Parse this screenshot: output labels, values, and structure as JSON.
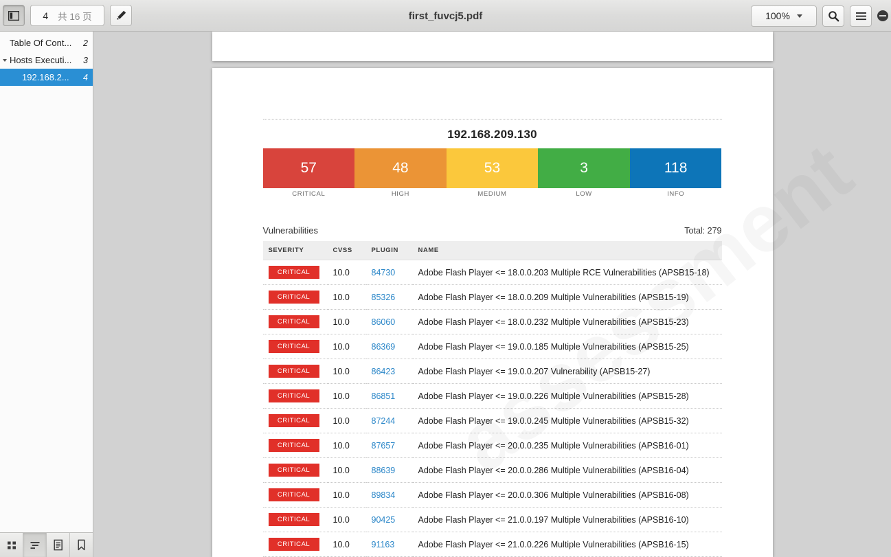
{
  "window": {
    "title": "first_fuvcj5.pdf"
  },
  "toolbar": {
    "sidebar_toggle_icon": "sidebar-panel-icon",
    "current_page": "4",
    "page_total_label": "共 16 页",
    "edit_icon": "pencil-icon",
    "zoom_level": "100%",
    "zoom_caret_icon": "chevron-down-icon",
    "search_icon": "search-icon",
    "menu_icon": "hamburger-menu-icon",
    "minimize_icon": "minimize-icon"
  },
  "sidebar": {
    "outline": [
      {
        "label": "Table Of Cont...",
        "page": "2",
        "expandable": false,
        "indent": false,
        "selected": false
      },
      {
        "label": "Hosts Executi...",
        "page": "3",
        "expandable": true,
        "indent": false,
        "selected": false
      },
      {
        "label": "192.168.2...",
        "page": "4",
        "expandable": false,
        "indent": true,
        "selected": true
      }
    ],
    "tabs": [
      {
        "name": "thumbnails-tab",
        "icon": "grid-icon",
        "active": false
      },
      {
        "name": "outline-tab",
        "icon": "outline-list-icon",
        "active": true
      },
      {
        "name": "annotations-tab",
        "icon": "notepad-icon",
        "active": false
      },
      {
        "name": "bookmarks-tab",
        "icon": "bookmark-icon",
        "active": false
      }
    ]
  },
  "document": {
    "host_title": "192.168.209.130",
    "severity_summary": [
      {
        "label": "CRITICAL",
        "count": "57",
        "color": "#d8443c"
      },
      {
        "label": "HIGH",
        "count": "48",
        "color": "#eb9436"
      },
      {
        "label": "MEDIUM",
        "count": "53",
        "color": "#fbc83c"
      },
      {
        "label": "LOW",
        "count": "3",
        "color": "#42ad45"
      },
      {
        "label": "INFO",
        "count": "118",
        "color": "#0d75b8"
      }
    ],
    "vulnerabilities_label": "Vulnerabilities",
    "total_label": "Total: 279",
    "columns": [
      "SEVERITY",
      "CVSS",
      "PLUGIN",
      "NAME"
    ],
    "rows": [
      {
        "severity": "CRITICAL",
        "cvss": "10.0",
        "plugin": "84730",
        "name": "Adobe Flash Player <= 18.0.0.203 Multiple RCE Vulnerabilities (APSB15-18)"
      },
      {
        "severity": "CRITICAL",
        "cvss": "10.0",
        "plugin": "85326",
        "name": "Adobe Flash Player <= 18.0.0.209 Multiple Vulnerabilities (APSB15-19)"
      },
      {
        "severity": "CRITICAL",
        "cvss": "10.0",
        "plugin": "86060",
        "name": "Adobe Flash Player <= 18.0.0.232 Multiple Vulnerabilities (APSB15-23)"
      },
      {
        "severity": "CRITICAL",
        "cvss": "10.0",
        "plugin": "86369",
        "name": "Adobe Flash Player <= 19.0.0.185 Multiple Vulnerabilities (APSB15-25)"
      },
      {
        "severity": "CRITICAL",
        "cvss": "10.0",
        "plugin": "86423",
        "name": "Adobe Flash Player <= 19.0.0.207 Vulnerability (APSB15-27)"
      },
      {
        "severity": "CRITICAL",
        "cvss": "10.0",
        "plugin": "86851",
        "name": "Adobe Flash Player <= 19.0.0.226 Multiple Vulnerabilities (APSB15-28)"
      },
      {
        "severity": "CRITICAL",
        "cvss": "10.0",
        "plugin": "87244",
        "name": "Adobe Flash Player <= 19.0.0.245 Multiple Vulnerabilities (APSB15-32)"
      },
      {
        "severity": "CRITICAL",
        "cvss": "10.0",
        "plugin": "87657",
        "name": "Adobe Flash Player <= 20.0.0.235 Multiple Vulnerabilities (APSB16-01)"
      },
      {
        "severity": "CRITICAL",
        "cvss": "10.0",
        "plugin": "88639",
        "name": "Adobe Flash Player <= 20.0.0.286 Multiple Vulnerabilities (APSB16-04)"
      },
      {
        "severity": "CRITICAL",
        "cvss": "10.0",
        "plugin": "89834",
        "name": "Adobe Flash Player <= 20.0.0.306 Multiple Vulnerabilities (APSB16-08)"
      },
      {
        "severity": "CRITICAL",
        "cvss": "10.0",
        "plugin": "90425",
        "name": "Adobe Flash Player <= 21.0.0.197 Multiple Vulnerabilities (APSB16-10)"
      },
      {
        "severity": "CRITICAL",
        "cvss": "10.0",
        "plugin": "91163",
        "name": "Adobe Flash Player <= 21.0.0.226 Multiple Vulnerabilities (APSB16-15)"
      }
    ]
  }
}
